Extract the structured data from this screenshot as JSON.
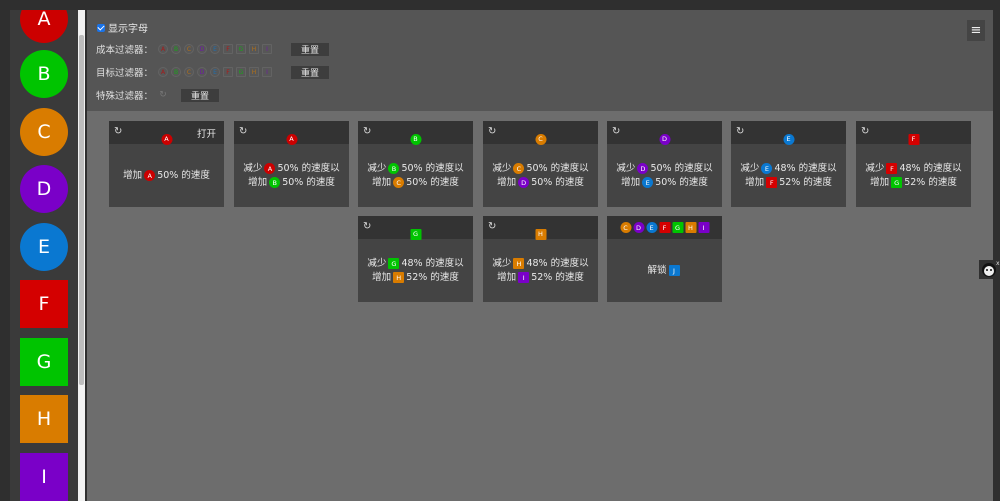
{
  "resources": [
    {
      "letter": "A",
      "color": "#cc0000",
      "shape": "circle"
    },
    {
      "letter": "B",
      "color": "#00c400",
      "shape": "circle"
    },
    {
      "letter": "C",
      "color": "#d97c00",
      "shape": "circle"
    },
    {
      "letter": "D",
      "color": "#7a00c8",
      "shape": "circle"
    },
    {
      "letter": "E",
      "color": "#0a78d1",
      "shape": "circle"
    },
    {
      "letter": "F",
      "color": "#d40000",
      "shape": "square"
    },
    {
      "letter": "G",
      "color": "#00c400",
      "shape": "square"
    },
    {
      "letter": "H",
      "color": "#d97c00",
      "shape": "square"
    },
    {
      "letter": "I",
      "color": "#7a00c8",
      "shape": "square"
    }
  ],
  "filters": {
    "show_letters_label": "显示字母",
    "cost_label": "成本过滤器：",
    "target_label": "目标过滤器：",
    "special_label": "特殊过滤器：",
    "reset_label": "重置",
    "letters": [
      "A",
      "B",
      "C",
      "D",
      "E",
      "F",
      "G",
      "H",
      "I"
    ]
  },
  "menu_icon": "≡",
  "cycle_icon": "↻",
  "cards": [
    {
      "head": [
        "A"
      ],
      "action": "打开",
      "lines": [
        [
          {
            "t": "增加"
          },
          {
            "b": "A"
          },
          {
            "t": "50% 的速度"
          }
        ]
      ]
    },
    {
      "head": [
        "A"
      ],
      "action": "",
      "lines": [
        [
          {
            "t": "减少"
          },
          {
            "b": "A"
          },
          {
            "t": "50% 的速度以"
          }
        ],
        [
          {
            "t": "增加"
          },
          {
            "b": "B"
          },
          {
            "t": "50% 的速度"
          }
        ]
      ]
    },
    {
      "head": [
        "B"
      ],
      "action": "",
      "lines": [
        [
          {
            "t": "减少"
          },
          {
            "b": "B"
          },
          {
            "t": "50% 的速度以"
          }
        ],
        [
          {
            "t": "增加"
          },
          {
            "b": "C"
          },
          {
            "t": "50% 的速度"
          }
        ]
      ]
    },
    {
      "head": [
        "C"
      ],
      "action": "",
      "lines": [
        [
          {
            "t": "减少"
          },
          {
            "b": "C"
          },
          {
            "t": "50% 的速度以"
          }
        ],
        [
          {
            "t": "增加"
          },
          {
            "b": "D"
          },
          {
            "t": "50% 的速度"
          }
        ]
      ]
    },
    {
      "head": [
        "D"
      ],
      "action": "",
      "lines": [
        [
          {
            "t": "减少"
          },
          {
            "b": "D"
          },
          {
            "t": "50% 的速度以"
          }
        ],
        [
          {
            "t": "增加"
          },
          {
            "b": "E"
          },
          {
            "t": "50% 的速度"
          }
        ]
      ]
    },
    {
      "head": [
        "E"
      ],
      "action": "",
      "lines": [
        [
          {
            "t": "减少"
          },
          {
            "b": "E"
          },
          {
            "t": "48% 的速度以"
          }
        ],
        [
          {
            "t": "增加"
          },
          {
            "b": "F"
          },
          {
            "t": "52% 的速度"
          }
        ]
      ]
    },
    {
      "head": [
        "F"
      ],
      "action": "",
      "lines": [
        [
          {
            "t": "减少"
          },
          {
            "b": "F"
          },
          {
            "t": "48% 的速度以"
          }
        ],
        [
          {
            "t": "增加"
          },
          {
            "b": "G"
          },
          {
            "t": "52% 的速度"
          }
        ]
      ]
    },
    {
      "head": [
        "G"
      ],
      "action": "",
      "lines": [
        [
          {
            "t": "减少"
          },
          {
            "b": "G"
          },
          {
            "t": "48% 的速度以"
          }
        ],
        [
          {
            "t": "增加"
          },
          {
            "b": "H"
          },
          {
            "t": "52% 的速度"
          }
        ]
      ]
    },
    {
      "head": [
        "H"
      ],
      "action": "",
      "lines": [
        [
          {
            "t": "减少"
          },
          {
            "b": "H"
          },
          {
            "t": "48% 的速度以"
          }
        ],
        [
          {
            "t": "增加"
          },
          {
            "b": "I"
          },
          {
            "t": "52% 的速度"
          }
        ]
      ]
    },
    {
      "head": [
        "C",
        "D",
        "E",
        "F",
        "G",
        "H",
        "I"
      ],
      "action": "",
      "nocycle": true,
      "lines": [
        [
          {
            "t": "解锁"
          },
          {
            "b": "J"
          }
        ]
      ]
    }
  ],
  "extra_colors": {
    "J": "#0a78d1"
  }
}
